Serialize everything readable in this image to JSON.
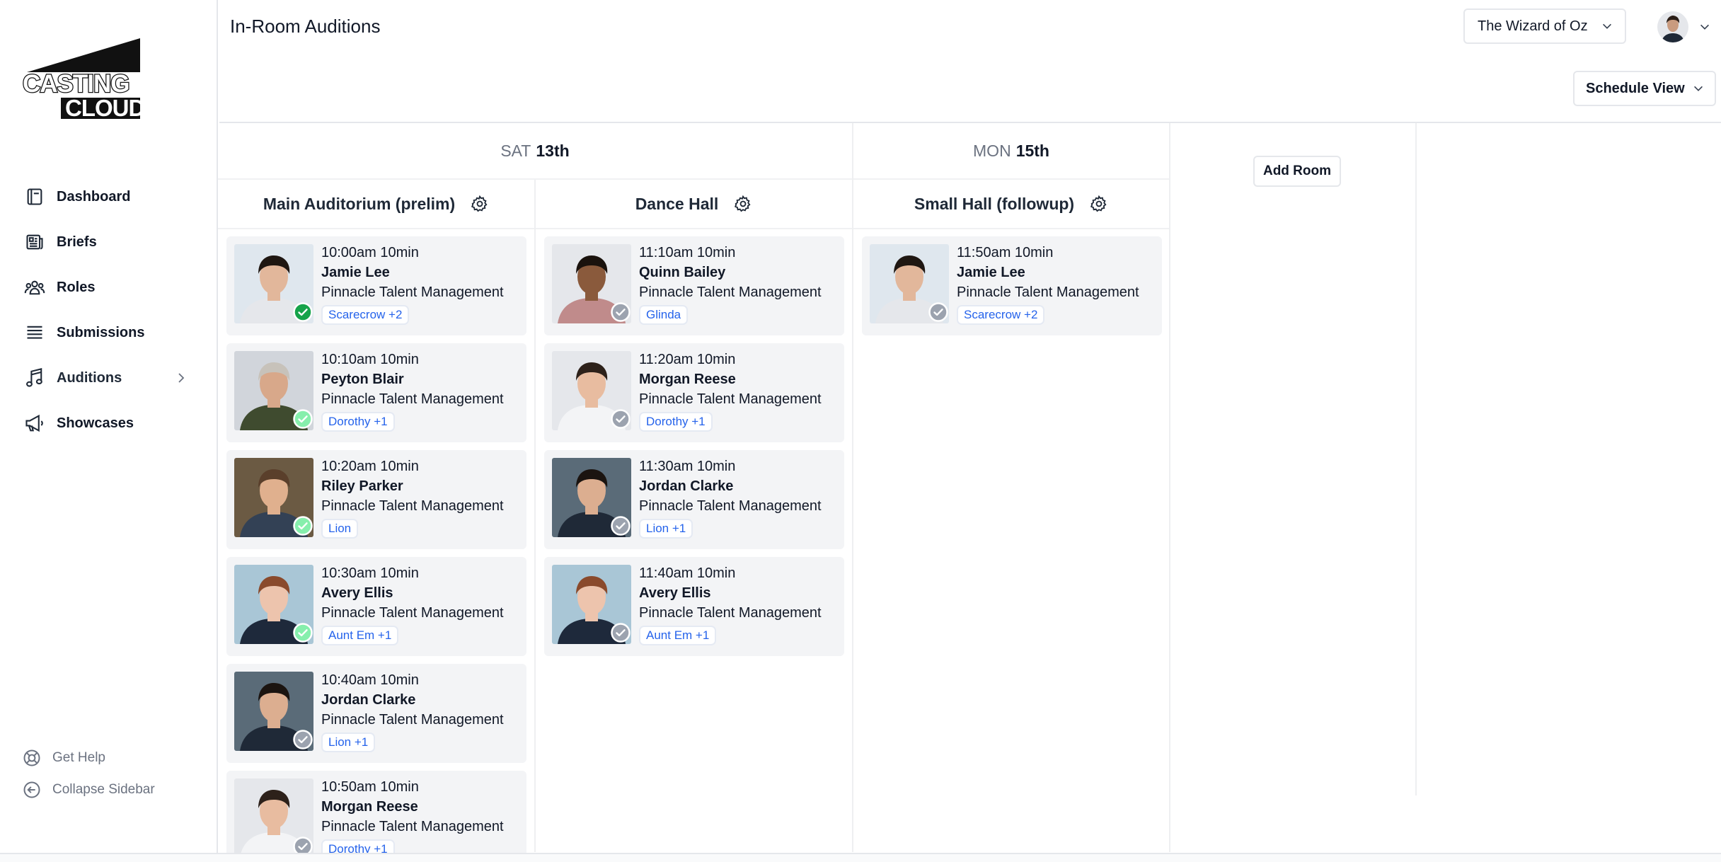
{
  "header": {
    "title": "In-Room Auditions",
    "production": "The Wizard of Oz",
    "view_mode": "Schedule View"
  },
  "logo": {
    "line1": "CASTING",
    "line2": "CLOUD"
  },
  "sidebar": {
    "items": [
      {
        "label": "Dashboard",
        "icon": "book-icon"
      },
      {
        "label": "Briefs",
        "icon": "newspaper-icon"
      },
      {
        "label": "Roles",
        "icon": "users-icon"
      },
      {
        "label": "Submissions",
        "icon": "queue-list-icon"
      },
      {
        "label": "Auditions",
        "icon": "music-note-icon"
      },
      {
        "label": "Showcases",
        "icon": "megaphone-icon"
      }
    ],
    "get_help": "Get Help",
    "collapse": "Collapse Sidebar"
  },
  "schedule": {
    "days": [
      {
        "dow": "SAT",
        "date": "13th"
      },
      {
        "dow": "MON",
        "date": "15th"
      }
    ],
    "add_room_label": "Add Room",
    "rooms": [
      {
        "name": "Main Auditorium (prelim)",
        "slots": [
          {
            "time": "10:00am 10min",
            "name": "Jamie Lee",
            "agency": "Pinnacle Talent Management",
            "roles": "Scarecrow +2",
            "status": "checked-in"
          },
          {
            "time": "10:10am 10min",
            "name": "Peyton Blair",
            "agency": "Pinnacle Talent Management",
            "roles": "Dorothy +1",
            "status": "confirmed"
          },
          {
            "time": "10:20am 10min",
            "name": "Riley Parker",
            "agency": "Pinnacle Talent Management",
            "roles": "Lion",
            "status": "confirmed"
          },
          {
            "time": "10:30am 10min",
            "name": "Avery Ellis",
            "agency": "Pinnacle Talent Management",
            "roles": "Aunt Em +1",
            "status": "confirmed"
          },
          {
            "time": "10:40am 10min",
            "name": "Jordan Clarke",
            "agency": "Pinnacle Talent Management",
            "roles": "Lion +1",
            "status": "pending"
          },
          {
            "time": "10:50am 10min",
            "name": "Morgan Reese",
            "agency": "Pinnacle Talent Management",
            "roles": "Dorothy +1",
            "status": "pending"
          }
        ]
      },
      {
        "name": "Dance Hall",
        "slots": [
          {
            "time": "11:10am 10min",
            "name": "Quinn Bailey",
            "agency": "Pinnacle Talent Management",
            "roles": "Glinda",
            "status": "pending"
          },
          {
            "time": "11:20am 10min",
            "name": "Morgan Reese",
            "agency": "Pinnacle Talent Management",
            "roles": "Dorothy +1",
            "status": "pending"
          },
          {
            "time": "11:30am 10min",
            "name": "Jordan Clarke",
            "agency": "Pinnacle Talent Management",
            "roles": "Lion +1",
            "status": "pending"
          },
          {
            "time": "11:40am 10min",
            "name": "Avery Ellis",
            "agency": "Pinnacle Talent Management",
            "roles": "Aunt Em +1",
            "status": "pending"
          }
        ]
      },
      {
        "name": "Small Hall (followup)",
        "slots": [
          {
            "time": "11:50am 10min",
            "name": "Jamie Lee",
            "agency": "Pinnacle Talent Management",
            "roles": "Scarecrow +2",
            "status": "pending"
          }
        ]
      }
    ]
  },
  "colors": {
    "accent": "#2563eb",
    "check_dark": "#16a34a",
    "check_light": "#86efac",
    "check_pending": "#9ca3af",
    "card_bg": "#f3f4f6"
  }
}
